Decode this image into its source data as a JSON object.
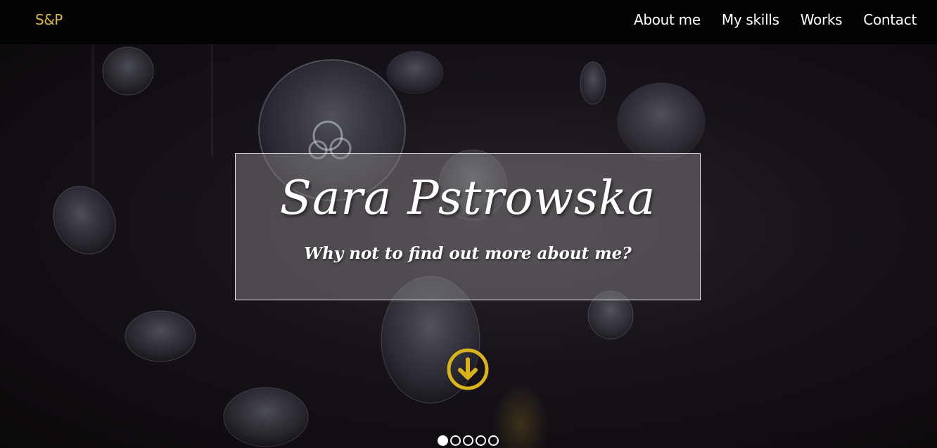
{
  "brand": {
    "logo": "S&P"
  },
  "nav": {
    "items": [
      {
        "label": "About me"
      },
      {
        "label": "My skills"
      },
      {
        "label": "Works"
      },
      {
        "label": "Contact"
      }
    ]
  },
  "hero": {
    "title": "Sara Pstrowska",
    "subtitle": "Why not to find out more about me?",
    "scroll_icon": "arrow-down-circle-icon",
    "background": "jellyfish-photo"
  },
  "slider": {
    "count": 5,
    "active_index": 0
  },
  "colors": {
    "accent": "#d8b31e",
    "logo": "#d8b54a",
    "navbar": "#030303",
    "text": "#ffffff"
  }
}
